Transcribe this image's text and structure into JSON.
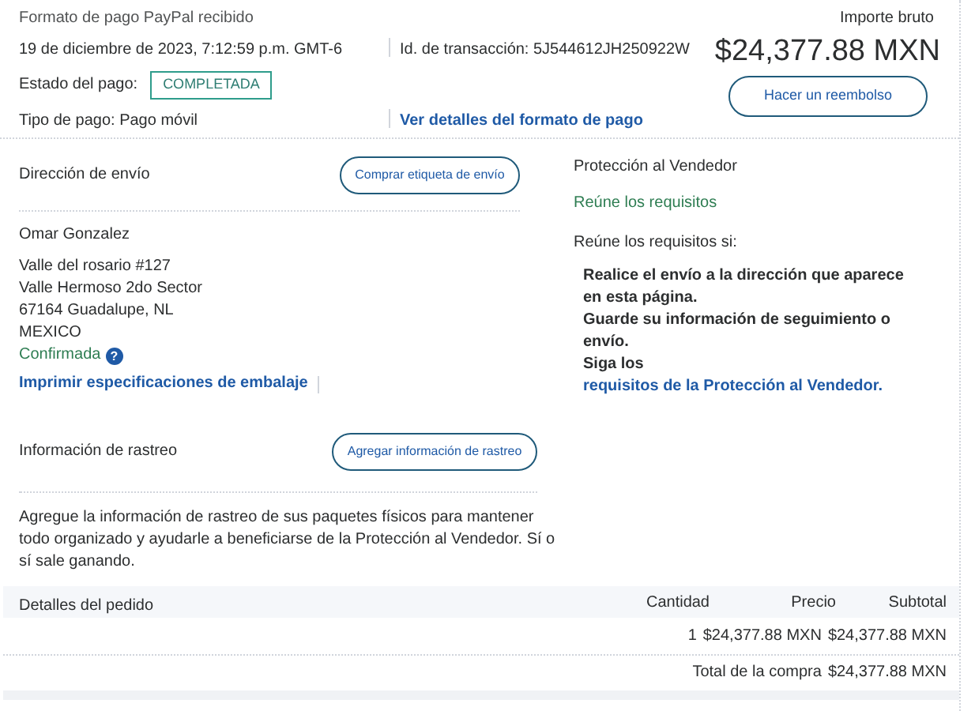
{
  "header": {
    "title": "Formato de pago PayPal recibido",
    "date": "19 de diciembre de 2023, 7:12:59 p.m. GMT-6",
    "transaction_id": "Id. de transacción: 5J544612JH250922W",
    "status_label": "Estado del pago:",
    "status_badge": "COMPLETADA",
    "payment_type": "Tipo de pago: Pago móvil",
    "details_link": "Ver detalles del formato de pago",
    "gross_label": "Importe bruto",
    "gross_amount": "$24,377.88 MXN",
    "refund_button": "Hacer un reembolso"
  },
  "shipping": {
    "title": "Dirección de envío",
    "button": "Comprar etiqueta de envío",
    "name": "Omar Gonzalez",
    "address_lines": [
      "Valle del rosario #127",
      "Valle Hermoso 2do Sector",
      "67164 Guadalupe, NL",
      "MEXICO"
    ],
    "confirmed": "Confirmada",
    "help_icon": "?",
    "print_link": "Imprimir especificaciones de embalaje"
  },
  "protection": {
    "title": "Protección al Vendedor",
    "status": "Reúne los requisitos",
    "conditions_title": "Reúne los requisitos si:",
    "conditions": [
      "Realice el envío a la dirección que aparece en esta página.",
      "Guarde su información de seguimiento o envío."
    ],
    "last_prefix": "Siga los",
    "last_link": "requisitos de la Protección al Vendedor."
  },
  "tracking": {
    "title": "Información de rastreo",
    "button": "Agregar información de rastreo",
    "description": "Agregue la información de rastreo de sus paquetes físicos para mantener todo organizado y ayudarle a beneficiarse de la Protección al Vendedor. Sí o sí sale ganando."
  },
  "order": {
    "columns": [
      "Detalles del pedido",
      "Cantidad",
      "Precio",
      "Subtotal"
    ],
    "rows": [
      {
        "quantity": "1",
        "price": "$24,377.88 MXN",
        "subtotal": "$24,377.88 MXN"
      }
    ],
    "total_label": "Total de la compra",
    "total_value": "$24,377.88 MXN"
  }
}
